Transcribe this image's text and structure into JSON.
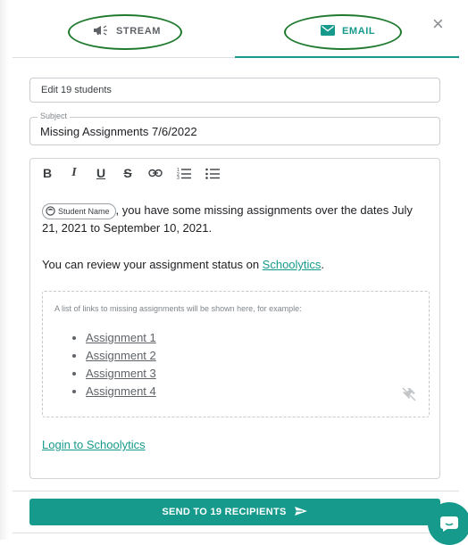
{
  "tabs": {
    "stream_label": "STREAM",
    "email_label": "EMAIL",
    "active": "EMAIL"
  },
  "recipients_field": {
    "value": "Edit 19 students"
  },
  "subject": {
    "label": "Subject",
    "value": "Missing Assignments 7/6/2022"
  },
  "toolbar": {
    "bold": "B",
    "italic": "I",
    "underline": "U",
    "strike": "S"
  },
  "message": {
    "chip_label": "Student Name",
    "line1": ", you have some missing assignments over the dates July 21, 2021 to September 10, 2021.",
    "line2_prefix": "You can review your assignment status on ",
    "line2_link": "Schoolytics",
    "line2_suffix": ".",
    "example_note": "A list of links to missing assignments will be shown here, for example:",
    "examples": [
      "Assignment 1",
      "Assignment 2",
      "Assignment 3",
      "Assignment 4"
    ],
    "login_link": "Login to Schoolytics"
  },
  "send_button": {
    "label": "SEND TO 19 RECIPIENTS"
  },
  "colors": {
    "accent": "#159a8c",
    "annotation": "#1f7a2e"
  },
  "icons": {
    "stream": "megaphone-icon",
    "email": "envelope-icon",
    "close": "close-icon",
    "send": "send-arrow-icon",
    "chat": "chat-bubble-icon",
    "pin": "pin-off-icon"
  }
}
